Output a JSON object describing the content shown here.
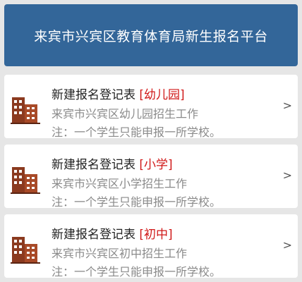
{
  "header": {
    "title": "来宾市兴宾区教育体育局新生报名平台"
  },
  "colors": {
    "header_bg": "#336699",
    "tag_red": "#d01818",
    "icon_brown": "#8b3a1f"
  },
  "cards": [
    {
      "title": "新建报名登记表",
      "tag": "[幼儿园]",
      "subtitle": "来宾市兴宾区幼儿园招生工作",
      "note": "注：一个学生只能申报一所学校。",
      "chevron": ">",
      "icon": "building-icon"
    },
    {
      "title": "新建报名登记表",
      "tag": "[小学]",
      "subtitle": "来宾市兴宾区小学招生工作",
      "note": "注：一个学生只能申报一所学校。",
      "chevron": ">",
      "icon": "building-icon"
    },
    {
      "title": "新建报名登记表",
      "tag": "[初中]",
      "subtitle": "来宾市兴宾区初中招生工作",
      "note": "注：一个学生只能申报一所学校。",
      "chevron": ">",
      "icon": "building-icon"
    }
  ]
}
